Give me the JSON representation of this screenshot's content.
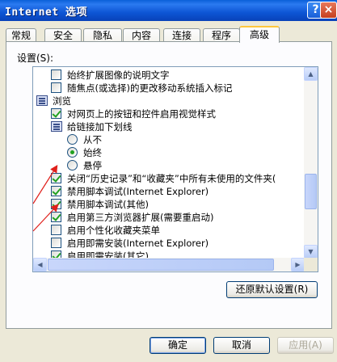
{
  "window": {
    "title": "Internet 选项",
    "help_label": "?",
    "close_label": "×"
  },
  "tabs": [
    "常规",
    "安全",
    "隐私",
    "内容",
    "连接",
    "程序",
    "高级"
  ],
  "active_tab": "高级",
  "settings_label": "设置(S):",
  "list_items": [
    {
      "type": "checkbox",
      "checked": false,
      "text": "始终扩展图像的说明文字"
    },
    {
      "type": "checkbox",
      "checked": false,
      "text": "随焦点(或选择)的更改移动系统插入标记"
    },
    {
      "type": "folder",
      "text": "浏览"
    },
    {
      "type": "checkbox",
      "checked": true,
      "text": "对网页上的按钮和控件启用视觉样式"
    },
    {
      "type": "folder",
      "text": "给链接加下划线"
    },
    {
      "type": "radio",
      "selected": false,
      "text": "从不"
    },
    {
      "type": "radio",
      "selected": true,
      "text": "始终"
    },
    {
      "type": "radio",
      "selected": false,
      "text": "悬停"
    },
    {
      "type": "checkbox",
      "checked": true,
      "text": "关闭“历史记录”和“收藏夹”中所有未使用的文件夹("
    },
    {
      "type": "checkbox",
      "checked": true,
      "text": "禁用脚本调试(Internet Explorer)"
    },
    {
      "type": "checkbox",
      "checked": true,
      "text": "禁用脚本调试(其他)"
    },
    {
      "type": "checkbox",
      "checked": true,
      "text": "启用第三方浏览器扩展(需要重启动)"
    },
    {
      "type": "checkbox",
      "checked": false,
      "text": "启用个性化收藏夹菜单"
    },
    {
      "type": "checkbox",
      "checked": false,
      "text": "启用即需安装(Internet Explorer)"
    },
    {
      "type": "checkbox",
      "checked": true,
      "text": "启用即需安装(其它)"
    }
  ],
  "restore_button": "还原默认设置(R)",
  "footer": {
    "ok": "确定",
    "cancel": "取消",
    "apply": "应用(A)"
  },
  "colors": {
    "title_bar": "#0a5fd8",
    "dialog_bg": "#ece9d8",
    "annotation_arrow": "#e0201b",
    "check": "#21a121"
  }
}
